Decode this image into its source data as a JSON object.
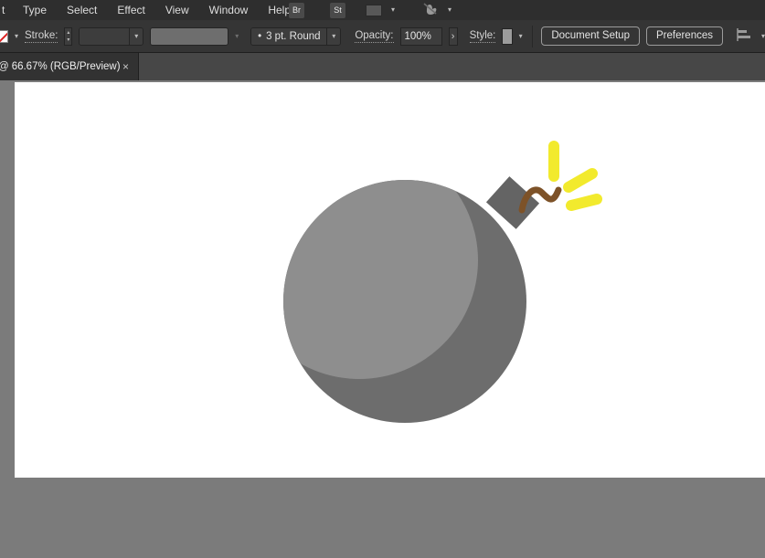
{
  "menubar": {
    "partial": "t",
    "items": [
      "Type",
      "Select",
      "Effect",
      "View",
      "Window",
      "Help"
    ],
    "bridge_label": "Br",
    "stock_label": "St"
  },
  "controlbar": {
    "stroke_label": "Stroke:",
    "brush_bullet": "•",
    "brush_value": "3 pt. Round",
    "opacity_label": "Opacity:",
    "opacity_value": "100%",
    "style_label": "Style:",
    "document_setup_label": "Document Setup",
    "preferences_label": "Preferences"
  },
  "tabbar": {
    "prefix": "@",
    "title": "66.67% (RGB/Preview)",
    "close": "×"
  },
  "icons": {
    "chevron_down": "▾",
    "chevron_up": "▴",
    "chevron_right": "›"
  },
  "colors": {
    "menubar_bg": "#2e2e2e",
    "controlbar_bg": "#353535",
    "tabstrip_bg": "#474747",
    "tab_bg": "#323232",
    "pasteboard": "#7b7b7b",
    "artboard": "#ffffff",
    "bomb_body": "#6d6d6d",
    "bomb_highlight": "#8e8e8e",
    "bomb_cap": "#646464",
    "fuse": "#7d5228",
    "spark": "#f2ea2d"
  }
}
